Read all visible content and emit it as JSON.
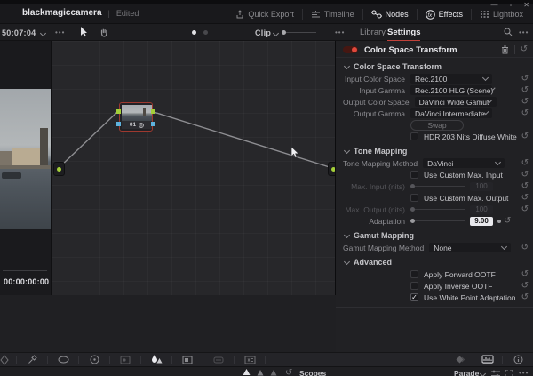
{
  "titlebar": {
    "title": "blackmagiccamera",
    "separator": "|",
    "status": "Edited",
    "window_controls": {
      "minimize": "—",
      "maximize": "▫",
      "close": "✕"
    },
    "nav": {
      "quick_export": "Quick Export",
      "timeline": "Timeline",
      "nodes": "Nodes",
      "effects": "Effects",
      "effects_glyph": "fx",
      "lightbox": "Lightbox"
    }
  },
  "toolbar": {
    "timecode": "50:07:04",
    "menu_dots": "•••",
    "clip_label": "Clip"
  },
  "tabs": {
    "library": "Library",
    "settings": "Settings",
    "menu_dots": "•••"
  },
  "viewer": {
    "timecode": "00:00:00:00"
  },
  "node_graph": {
    "node_label": "01"
  },
  "panel": {
    "title": "Color Space Transform",
    "sections": {
      "cst": {
        "title": "Color Space Transform",
        "input_color_space": {
          "label": "Input Color Space",
          "value": "Rec.2100"
        },
        "input_gamma": {
          "label": "Input Gamma",
          "value": "Rec.2100 HLG (Scene)"
        },
        "output_color_space": {
          "label": "Output Color Space",
          "value": "DaVinci Wide Gamut"
        },
        "output_gamma": {
          "label": "Output Gamma",
          "value": "DaVinci Intermediate"
        },
        "swap_label": "Swap",
        "hdr_checkbox": {
          "label": "HDR 203 Nits Diffuse White",
          "checked": false
        }
      },
      "tone": {
        "title": "Tone Mapping",
        "method": {
          "label": "Tone Mapping Method",
          "value": "DaVinci"
        },
        "use_custom_max_input": {
          "label": "Use Custom Max. Input",
          "checked": false
        },
        "max_input": {
          "label": "Max. Input (nits)",
          "value": "100",
          "disabled": true
        },
        "use_custom_max_output": {
          "label": "Use Custom Max. Output",
          "checked": false
        },
        "max_output": {
          "label": "Max. Output (nits)",
          "value": "100",
          "disabled": true
        },
        "adaptation": {
          "label": "Adaptation",
          "value": "9.00"
        }
      },
      "gamut": {
        "title": "Gamut Mapping",
        "method": {
          "label": "Gamut Mapping Method",
          "value": "None"
        }
      },
      "advanced": {
        "title": "Advanced",
        "apply_forward_ootf": {
          "label": "Apply Forward OOTF",
          "checked": false
        },
        "apply_inverse_ootf": {
          "label": "Apply Inverse OOTF",
          "checked": false
        },
        "use_white_point_adaptation": {
          "label": "Use White Point Adaptation",
          "checked": true
        }
      }
    }
  },
  "footer": {
    "scopes_label": "Scopes",
    "parade_label": "Parade",
    "menu_dots": "•••"
  },
  "icons": {
    "check": "✓",
    "reset": "↺",
    "keyframe_diamond": "◆"
  },
  "colors": {
    "accent_red": "#d0443a",
    "toggle_dot": "#e0483c",
    "node_green": "#a4cf39",
    "node_blue": "#5fb2dd",
    "selected_node_border": "#9e392f"
  }
}
